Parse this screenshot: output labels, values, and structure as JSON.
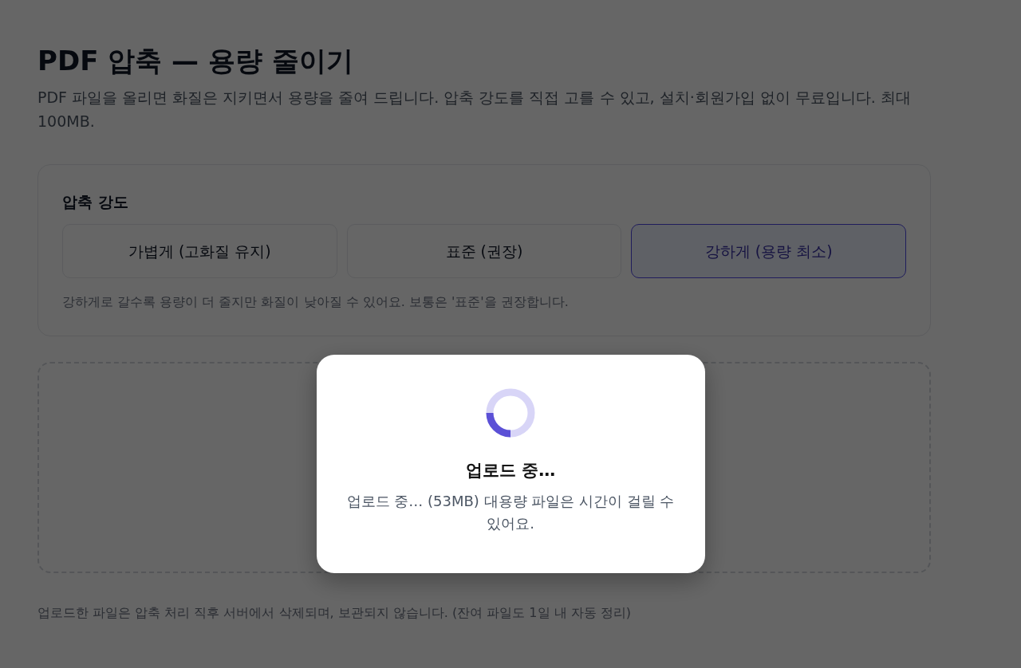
{
  "page": {
    "title": "PDF 압축 — 용량 줄이기",
    "description": "PDF 파일을 올리면 화질은 지키면서 용량을 줄여 드립니다. 압축 강도를 직접 고를 수 있고, 설치·회원가입 없이 무료입니다. 최대 100MB."
  },
  "compression": {
    "label": "압축 강도",
    "options": [
      {
        "label": "가볍게 (고화질 유지)",
        "selected": false
      },
      {
        "label": "표준 (권장)",
        "selected": false
      },
      {
        "label": "강하게 (용량 최소)",
        "selected": true
      }
    ],
    "hint": "강하게로 갈수록 용량이 더 줄지만 화질이 낮아질 수 있어요. 보통은 '표준'을 권장합니다."
  },
  "footer_note": "업로드한 파일은 압축 처리 직후 서버에서 삭제되며, 보관되지 않습니다. (잔여 파일도 1일 내 자동 정리)",
  "modal": {
    "title": "업로드 중…",
    "message": "업로드 중… (53MB) 대용량 파일은 시간이 걸릴 수 있어요."
  }
}
